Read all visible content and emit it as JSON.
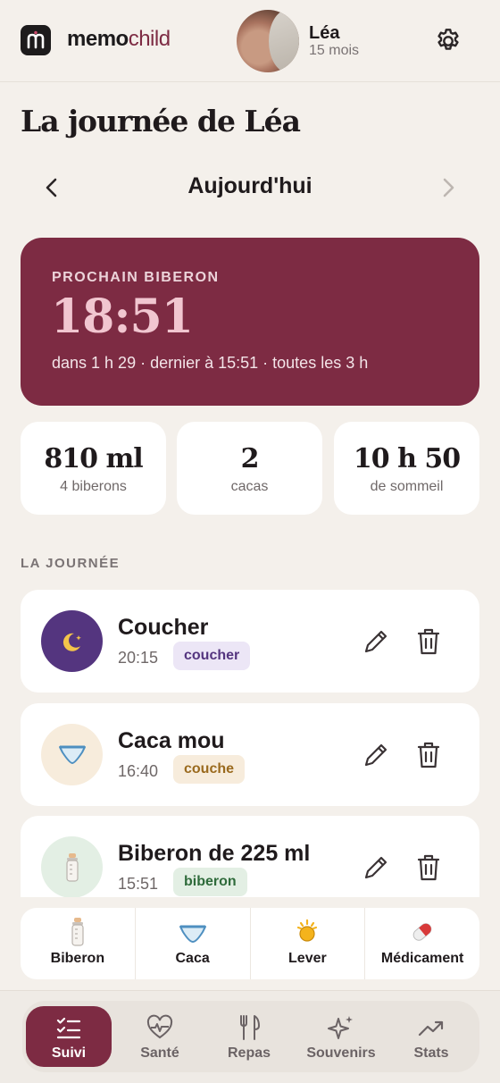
{
  "header": {
    "logo_memo": "memo",
    "logo_child": "child",
    "child_name": "Léa",
    "child_age": "15 mois"
  },
  "page": {
    "title": "La journée de Léa",
    "date_label": "Aujourd'hui"
  },
  "next_feeding": {
    "label": "PROCHAIN BIBERON",
    "time": "18:51",
    "details": "dans 1 h 29 · dernier à 15:51 · toutes les 3 h"
  },
  "stats": [
    {
      "value": "810 ml",
      "label": "4 biberons"
    },
    {
      "value": "2",
      "label": "cacas"
    },
    {
      "value": "10 h 50",
      "label": "de sommeil"
    }
  ],
  "section_label": "LA JOURNÉE",
  "entries": [
    {
      "title": "Coucher",
      "time": "20:15",
      "tag": "coucher",
      "icon": "moon-icon"
    },
    {
      "title": "Caca mou",
      "time": "16:40",
      "tag": "couche",
      "icon": "diaper-icon"
    },
    {
      "title": "Biberon de 225 ml",
      "time": "15:51",
      "tag": "biberon",
      "icon": "bottle-icon"
    }
  ],
  "quick_actions": [
    {
      "label": "Biberon",
      "icon": "bottle-icon"
    },
    {
      "label": "Caca",
      "icon": "diaper-icon"
    },
    {
      "label": "Lever",
      "icon": "sun-icon"
    },
    {
      "label": "Médicament",
      "icon": "pill-icon"
    }
  ],
  "tabs": [
    {
      "label": "Suivi",
      "icon": "checklist-icon",
      "active": true
    },
    {
      "label": "Santé",
      "icon": "heart-pulse-icon",
      "active": false
    },
    {
      "label": "Repas",
      "icon": "cutlery-icon",
      "active": false
    },
    {
      "label": "Souvenirs",
      "icon": "sparkles-icon",
      "active": false
    },
    {
      "label": "Stats",
      "icon": "trend-icon",
      "active": false
    }
  ],
  "colors": {
    "brand": "#7d2b43",
    "background": "#f4f0eb",
    "tag_coucher_bg": "#ece6f6",
    "tag_couche_bg": "#f7ecdc",
    "tag_biberon_bg": "#e3efe4"
  }
}
